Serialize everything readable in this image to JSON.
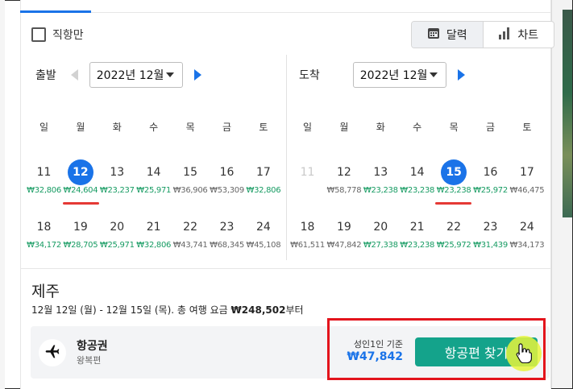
{
  "filters": {
    "direct_only_label": "직항만",
    "direct_only_checked": false
  },
  "view_toggle": {
    "options": [
      {
        "label": "달력",
        "icon": "calendar-icon",
        "active": true
      },
      {
        "label": "차트",
        "icon": "bar-chart-icon",
        "active": false
      }
    ]
  },
  "departure": {
    "label": "출발",
    "month": "2022년 12월",
    "weekdays": [
      "일",
      "월",
      "화",
      "수",
      "목",
      "금",
      "토"
    ],
    "weeks": [
      [
        {
          "day": "11",
          "price": "₩32,806",
          "tone": "green"
        },
        {
          "day": "12",
          "price": "₩24,604",
          "tone": "green",
          "selected": true
        },
        {
          "day": "13",
          "price": "₩23,237",
          "tone": "green"
        },
        {
          "day": "14",
          "price": "₩25,971",
          "tone": "green"
        },
        {
          "day": "15",
          "price": "₩36,906",
          "tone": "gray"
        },
        {
          "day": "16",
          "price": "₩53,309",
          "tone": "gray"
        },
        {
          "day": "17",
          "price": "₩32,806",
          "tone": "green"
        }
      ],
      [
        {
          "day": "18",
          "price": "₩34,172",
          "tone": "green"
        },
        {
          "day": "19",
          "price": "₩28,705",
          "tone": "green"
        },
        {
          "day": "20",
          "price": "₩25,971",
          "tone": "green"
        },
        {
          "day": "21",
          "price": "₩32,806",
          "tone": "green"
        },
        {
          "day": "22",
          "price": "₩43,741",
          "tone": "gray"
        },
        {
          "day": "23",
          "price": "₩68,345",
          "tone": "gray"
        },
        {
          "day": "24",
          "price": "₩45,108",
          "tone": "gray"
        }
      ]
    ]
  },
  "arrival": {
    "label": "도착",
    "month": "2022년 12월",
    "weekdays": [
      "일",
      "월",
      "화",
      "수",
      "목",
      "금",
      "토"
    ],
    "weeks": [
      [
        {
          "day": "11",
          "price": "",
          "tone": "gray",
          "disabled": true
        },
        {
          "day": "12",
          "price": "₩58,778",
          "tone": "gray"
        },
        {
          "day": "13",
          "price": "₩23,238",
          "tone": "green"
        },
        {
          "day": "14",
          "price": "₩23,238",
          "tone": "green"
        },
        {
          "day": "15",
          "price": "₩23,238",
          "tone": "green",
          "selected": true
        },
        {
          "day": "16",
          "price": "₩25,972",
          "tone": "green"
        },
        {
          "day": "17",
          "price": "₩46,475",
          "tone": "gray"
        }
      ],
      [
        {
          "day": "18",
          "price": "₩61,511",
          "tone": "gray"
        },
        {
          "day": "19",
          "price": "₩47,842",
          "tone": "gray"
        },
        {
          "day": "20",
          "price": "₩27,338",
          "tone": "green"
        },
        {
          "day": "21",
          "price": "₩23,238",
          "tone": "green"
        },
        {
          "day": "22",
          "price": "₩25,972",
          "tone": "green"
        },
        {
          "day": "23",
          "price": "₩31,439",
          "tone": "green"
        },
        {
          "day": "24",
          "price": "₩34,173",
          "tone": "gray"
        }
      ]
    ]
  },
  "summary": {
    "destination": "제주",
    "trip_prefix": "12월 12일 (월) - 12월 15일 (목). 총 여행 요금 ",
    "trip_total": "₩248,502",
    "trip_suffix": "부터"
  },
  "result_card": {
    "title": "항공권",
    "subtitle": "왕복편",
    "per_adult_label": "성인1인 기준",
    "fare": "₩47,842",
    "cta_label": "항공편 찾기"
  },
  "colors": {
    "accent": "#1a73e8",
    "cta": "#14a38b",
    "price_green": "#169b62",
    "annotation_red": "#e3141c"
  }
}
